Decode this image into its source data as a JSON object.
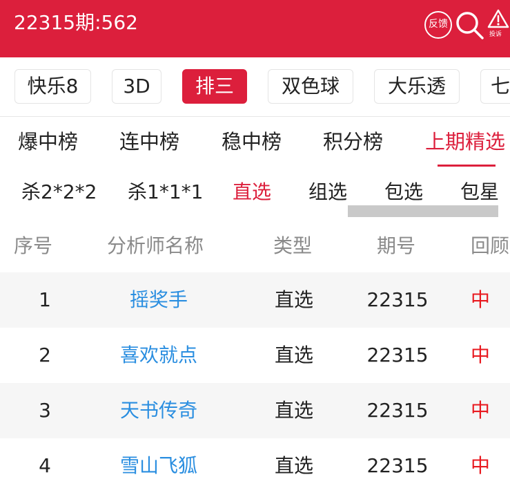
{
  "header": {
    "title": "22315期:562",
    "feedback_label": "反馈",
    "report_label": "投诉",
    "bg_color": "#dc1f3c"
  },
  "lottery_tabs": [
    {
      "label": "快乐8",
      "active": false
    },
    {
      "label": "3D",
      "active": false
    },
    {
      "label": "排三",
      "active": true
    },
    {
      "label": "双色球",
      "active": false
    },
    {
      "label": "大乐透",
      "active": false
    },
    {
      "label": "七",
      "active": false
    }
  ],
  "rank_tabs": [
    {
      "label": "爆中榜",
      "active": false
    },
    {
      "label": "连中榜",
      "active": false
    },
    {
      "label": "稳中榜",
      "active": false
    },
    {
      "label": "积分榜",
      "active": false
    },
    {
      "label": "上期精选",
      "active": true
    }
  ],
  "play_tabs": [
    {
      "label": "杀2*2*2",
      "active": false
    },
    {
      "label": "杀1*1*1",
      "active": false
    },
    {
      "label": "直选",
      "active": true
    },
    {
      "label": "组选",
      "active": false
    },
    {
      "label": "包选",
      "active": false
    },
    {
      "label": "包星",
      "active": false
    }
  ],
  "table": {
    "columns": [
      "序号",
      "分析师名称",
      "类型",
      "期号",
      "回顾"
    ],
    "rows": [
      {
        "index": "1",
        "name": "摇奖手",
        "type": "直选",
        "issue": "22315",
        "review": "中"
      },
      {
        "index": "2",
        "name": "喜欢就点",
        "type": "直选",
        "issue": "22315",
        "review": "中"
      },
      {
        "index": "3",
        "name": "天书传奇",
        "type": "直选",
        "issue": "22315",
        "review": "中"
      },
      {
        "index": "4",
        "name": "雪山飞狐",
        "type": "直选",
        "issue": "22315",
        "review": "中"
      }
    ]
  },
  "icons": {
    "search": "search-icon",
    "report": "warning-triangle-icon"
  },
  "colors": {
    "accent": "#dc1f3c",
    "link": "#2a8ee0",
    "hit": "#e8191f"
  }
}
